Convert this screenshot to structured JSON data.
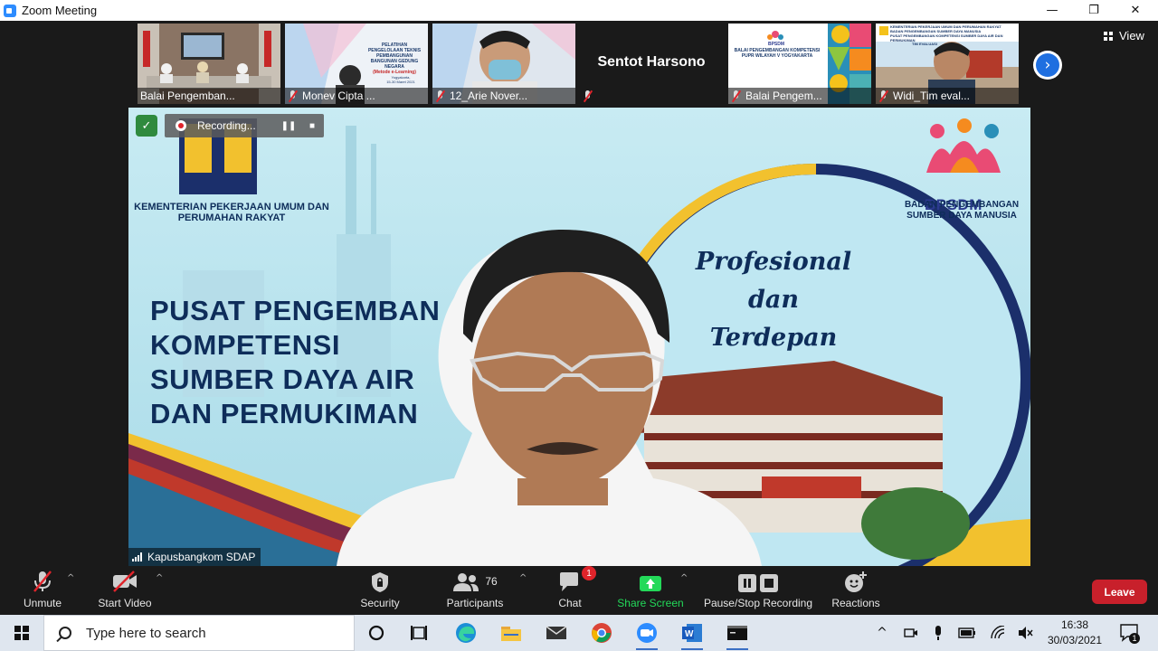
{
  "window": {
    "title": "Zoom Meeting",
    "controls": {
      "minimize": "—",
      "restore": "❐",
      "close": "✕"
    }
  },
  "thumbnails": [
    {
      "name": "Balai Pengemban...",
      "muted": false
    },
    {
      "name": "Monev Cipta ...",
      "muted": true,
      "slide_title": "PELATIHAN",
      "slide_sub": "PENGELOLAAN TEKNIS PEMBANGUNAN BANGUNAN GEDUNG NEGARA",
      "slide_note": "(Metode e-Learning)",
      "slide_place": "Yogyakarta,",
      "slide_date": "15-30 Maret 2021"
    },
    {
      "name": "12_Arie Nover...",
      "muted": true
    },
    {
      "name": "",
      "muted": true,
      "display_name": "Sentot Harsono"
    },
    {
      "name": "Balai Pengem...",
      "muted": true,
      "slide_brand": "BPSDM",
      "slide_title": "BALAI PENGEMBANGAN KOMPETENSI PUPR WILAYAH V YOGYAKARTA"
    },
    {
      "name": "Widi_Tim eval...",
      "muted": true,
      "slide_title": "KEMENTERIAN PEKERJAAN UMUM DAN PERUMAHAN RAKYAT",
      "slide_sub": "BADAN PENGEMBANGAN SUMBER DAYA MANUSIA",
      "slide_note": "PUSAT PENGEMBANGAN KOMPETENSI SUMBER DAYA AIR DAN PERMUKIMAN",
      "slide_team": "TIM EVALUASI"
    }
  ],
  "view_button": "View",
  "next_icon": "chevron-right-icon",
  "recording": {
    "status": "Recording...",
    "pause": "❚❚",
    "stop": "■"
  },
  "main_slide": {
    "ministry": "KEMENTERIAN PEKERJAAN UMUM DAN PERUMAHAN RAKYAT",
    "bpsdm": "BPSDM",
    "bpsdm_sub": "BADAN PENGEMBANGAN SUMBER DAYA MANUSIA",
    "headline": [
      "PUSAT PENGEMBAN",
      "KOMPETENSI",
      "SUMBER DAYA AIR",
      "DAN PERMUKIMAN"
    ],
    "tagline": [
      "Profesional",
      "dan",
      "Terdepan"
    ]
  },
  "active_speaker": "Kapusbangkom SDAP",
  "controls": {
    "unmute": "Unmute",
    "start_video": "Start Video",
    "security": "Security",
    "participants": "Participants",
    "participants_count": "76",
    "chat": "Chat",
    "chat_badge": "1",
    "share_screen": "Share Screen",
    "recording": "Pause/Stop Recording",
    "reactions": "Reactions",
    "leave": "Leave",
    "caret": "^"
  },
  "taskbar": {
    "search_placeholder": "Type here to search",
    "time": "16:38",
    "date": "30/03/2021",
    "notification_count": "1",
    "tray_up": "^"
  },
  "colors": {
    "accent": "#2d8cff",
    "share_green": "#23d959",
    "leave_red": "#c8202b",
    "rec_red": "#e0242b",
    "navy": "#0e2d5a"
  }
}
